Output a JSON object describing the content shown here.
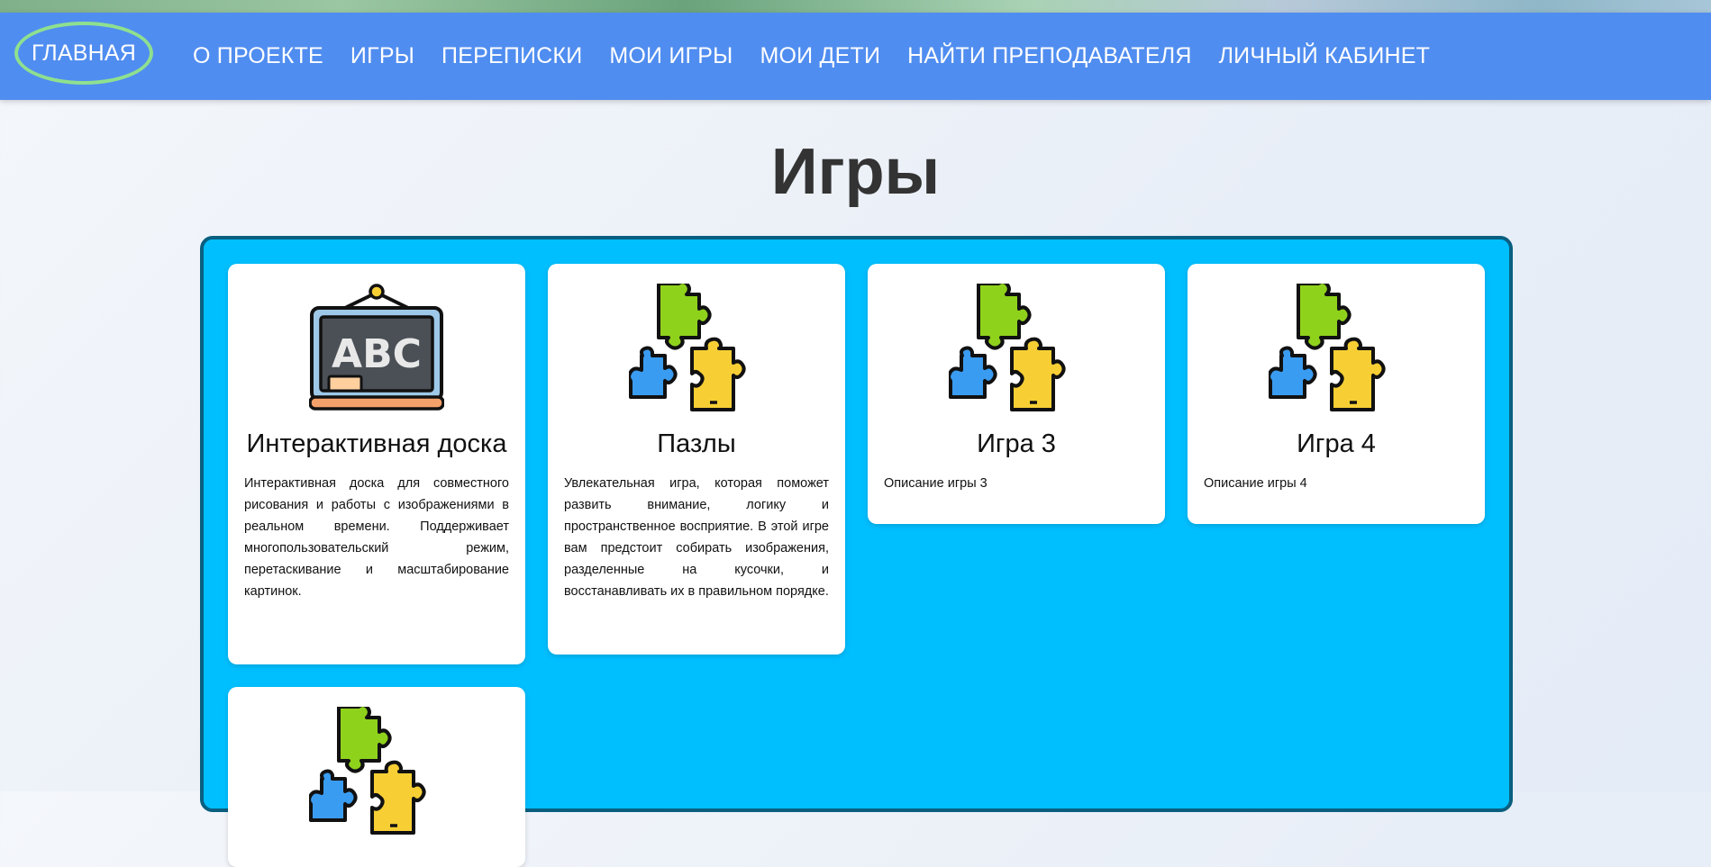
{
  "nav": {
    "home": "ГЛАВНАЯ",
    "items": [
      {
        "label": "О ПРОЕКТЕ"
      },
      {
        "label": "ИГРЫ"
      },
      {
        "label": "ПЕРЕПИСКИ"
      },
      {
        "label": "МОИ ИГРЫ"
      },
      {
        "label": "МОИ ДЕТИ"
      },
      {
        "label": "НАЙТИ ПРЕПОДАВАТЕЛЯ"
      },
      {
        "label": "ЛИЧНЫЙ КАБИНЕТ"
      }
    ]
  },
  "page": {
    "title": "Игры"
  },
  "games": [
    {
      "icon": "chalkboard-abc-icon",
      "board_text": "ABC",
      "title": "Интерактивная доска",
      "description": "Интерактивная доска для совместного рисования и работы с изображениями в реальном времени. Поддерживает многопользовательский режим, перетаскивание и масштабирование картинок."
    },
    {
      "icon": "puzzle-pieces-icon",
      "title": "Пазлы",
      "description": "Увлекательная игра, которая поможет развить внимание, логику и пространственное восприятие. В этой игре вам предстоит собирать изображения, разделенные на кусочки, и восстанавливать их в правильном порядке."
    },
    {
      "icon": "puzzle-pieces-icon",
      "title": "Игра 3",
      "description": "Описание игры 3"
    },
    {
      "icon": "puzzle-pieces-icon",
      "title": "Игра 4",
      "description": "Описание игры 4"
    },
    {
      "icon": "puzzle-pieces-icon",
      "title": "",
      "description": ""
    }
  ],
  "colors": {
    "nav_bg": "#508df0",
    "home_ring": "#8fe08f",
    "panel_bg": "#00bfff",
    "panel_border": "#0a5f80",
    "puzzle_green": "#8fd21c",
    "puzzle_blue": "#3a9cf0",
    "puzzle_yellow": "#f7cf35"
  }
}
